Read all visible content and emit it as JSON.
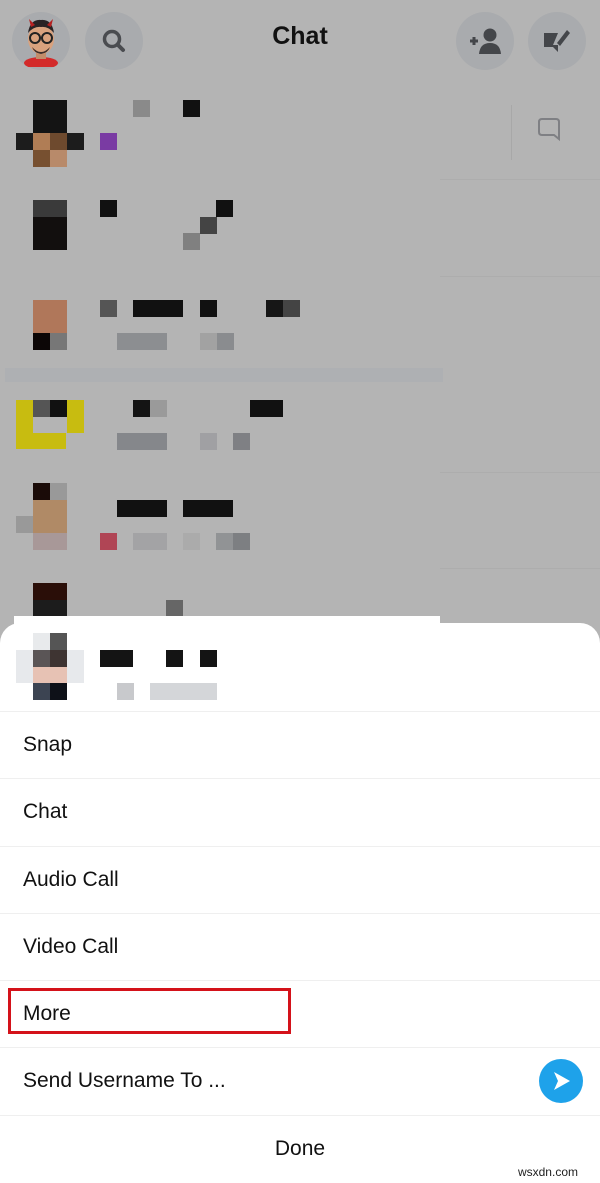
{
  "header": {
    "title": "Chat",
    "avatar_icon": "bitmoji-avatar-icon",
    "search_icon": "search-icon",
    "add_friend_icon": "add-friend-icon",
    "new_chat_icon": "new-chat-icon"
  },
  "chat_list": {
    "reply_icon": "chat-bubble-icon",
    "rows_note": "pixelated contact entries"
  },
  "sheet": {
    "menu_items": [
      {
        "label": "Snap"
      },
      {
        "label": "Chat"
      },
      {
        "label": "Audio Call"
      },
      {
        "label": "Video Call"
      },
      {
        "label": "More",
        "highlighted": true
      },
      {
        "label": "Send Username To ...",
        "icon": "send-arrow-icon"
      }
    ],
    "done_label": "Done"
  },
  "colors": {
    "highlight": "#d4121a",
    "send_icon": "#1ea2ea",
    "overlay": "#b4b4b4"
  },
  "watermark": "wsxdn.com"
}
